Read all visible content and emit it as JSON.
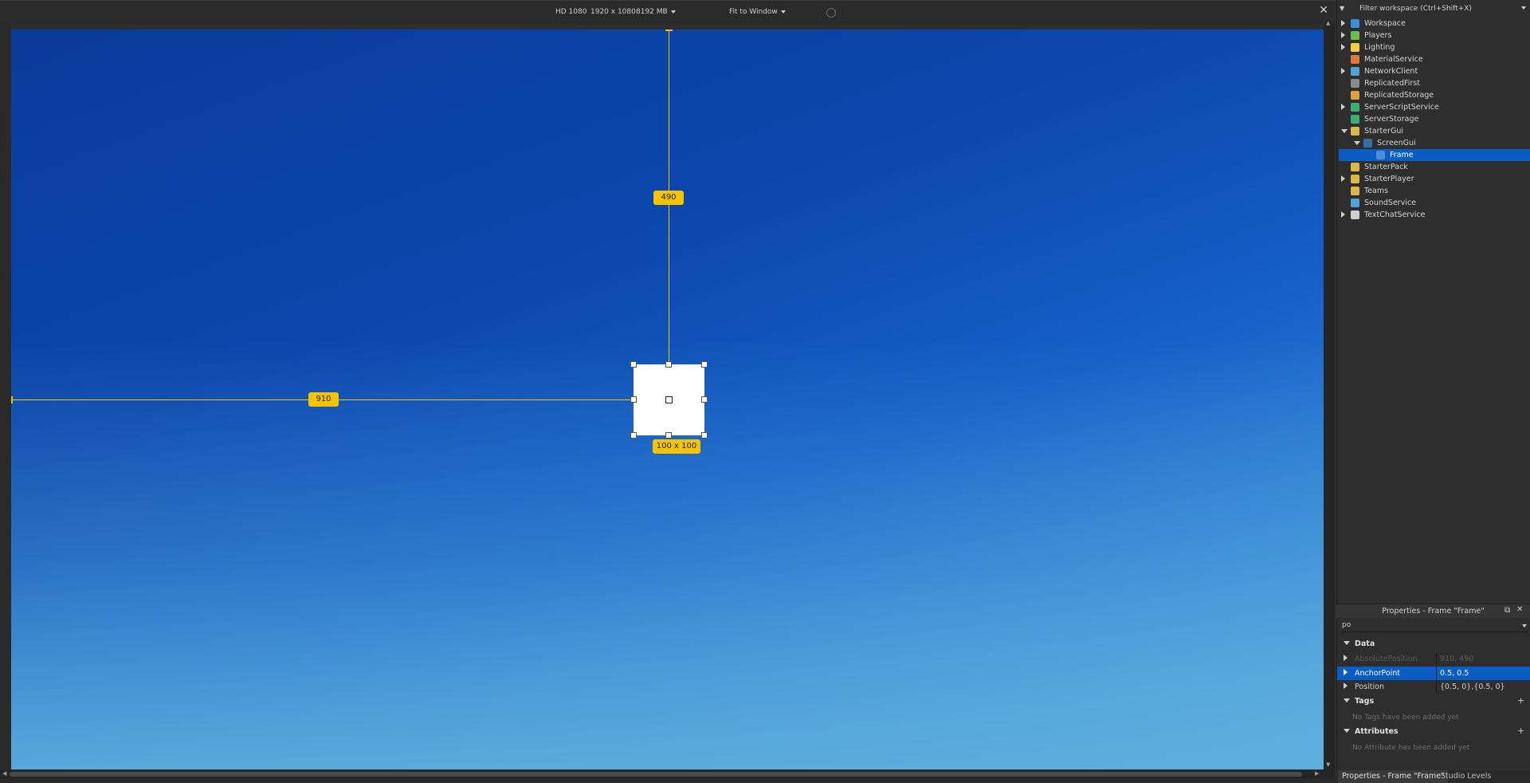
{
  "toolbar": {
    "device": "HD 1080",
    "resolution": "1920 x 1080",
    "memory": "8192 MB",
    "fit": "Fit to Window"
  },
  "viewport": {
    "guide_vertical_label": "490",
    "guide_horizontal_label": "910",
    "frame_size_label": "100 x 100"
  },
  "explorer": {
    "filter_placeholder": "Filter workspace (Ctrl+Shift+X)",
    "items": [
      {
        "label": "Workspace",
        "icon": "workspace-icon"
      },
      {
        "label": "Players",
        "icon": "players-icon"
      },
      {
        "label": "Lighting",
        "icon": "lighting-icon"
      },
      {
        "label": "MaterialService",
        "icon": "material-service-icon"
      },
      {
        "label": "NetworkClient",
        "icon": "network-client-icon"
      },
      {
        "label": "ReplicatedFirst",
        "icon": "replicated-first-icon"
      },
      {
        "label": "ReplicatedStorage",
        "icon": "replicated-storage-icon"
      },
      {
        "label": "ServerScriptService",
        "icon": "server-script-service-icon"
      },
      {
        "label": "ServerStorage",
        "icon": "server-storage-icon"
      },
      {
        "label": "StarterGui",
        "icon": "starter-gui-icon"
      },
      {
        "label": "ScreenGui",
        "icon": "screen-gui-icon"
      },
      {
        "label": "Frame",
        "icon": "frame-icon"
      },
      {
        "label": "StarterPack",
        "icon": "starter-pack-icon"
      },
      {
        "label": "StarterPlayer",
        "icon": "starter-player-icon"
      },
      {
        "label": "Teams",
        "icon": "teams-icon"
      },
      {
        "label": "SoundService",
        "icon": "sound-service-icon"
      },
      {
        "label": "TextChatService",
        "icon": "text-chat-service-icon"
      }
    ]
  },
  "properties": {
    "title": "Properties - Frame \"Frame\"",
    "filter_value": "po",
    "sections": {
      "data": "Data",
      "tags": "Tags",
      "attributes": "Attributes"
    },
    "rows": [
      {
        "name": "AbsolutePosition",
        "value": "910, 490"
      },
      {
        "name": "AnchorPoint",
        "value": "0.5, 0.5"
      },
      {
        "name": "Position",
        "value": "{0.5, 0},{0.5, 0}"
      }
    ],
    "tags_empty": "No Tags have been added yet",
    "attributes_empty": "No Attribute has been added yet"
  },
  "bottom_tabs": {
    "properties_tab": "Properties - Frame \"Frame\"",
    "studio_levels_tab": "Studio Levels"
  },
  "colors": {
    "guide": "#f5c400",
    "selection": "#0a5dc2",
    "panel_bg": "#2e2e2e"
  }
}
